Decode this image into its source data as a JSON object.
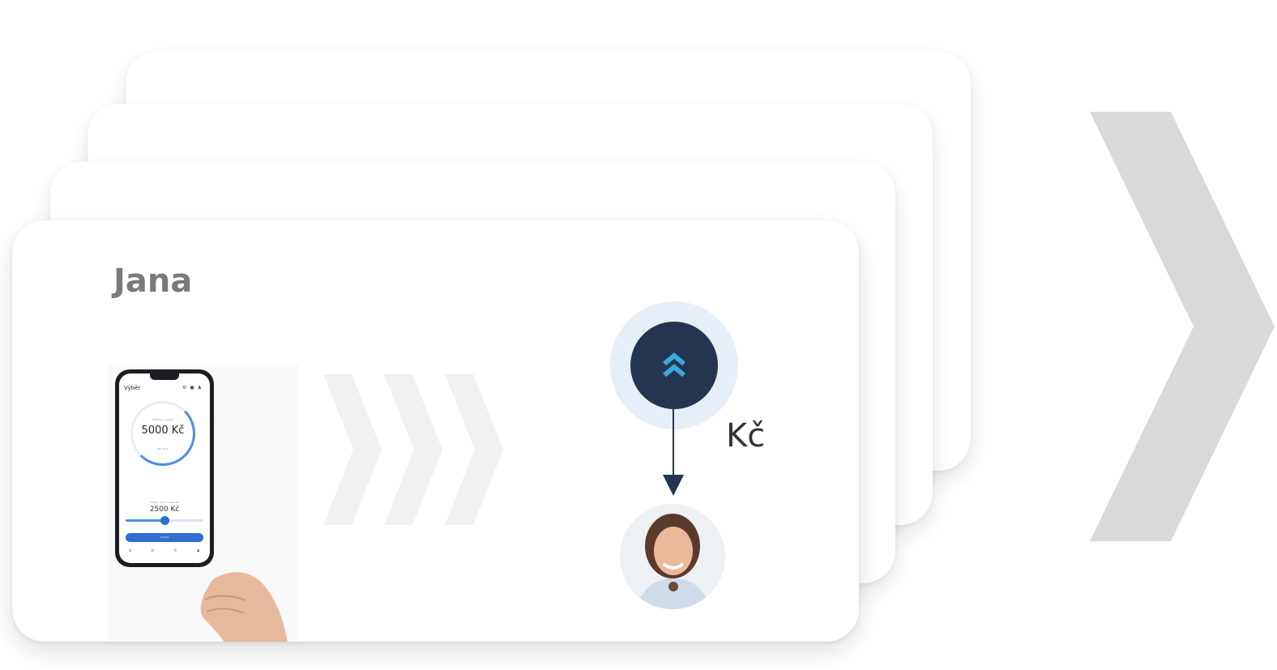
{
  "card": {
    "name": "Jana",
    "currency": "Kč"
  },
  "phone_app": {
    "title": "Výběr",
    "ring_caption": "Můžete si vybrat",
    "ring_value": "5000 Kč",
    "ring_link": "Jak na to",
    "slider_caption": "Částka, kterou vyberete",
    "slider_value": "2500  Kč",
    "slider_level": 0.5,
    "button_label": "Vybrat"
  },
  "colors": {
    "badge_navy": "#24364f",
    "badge_accent": "#3aa7e0",
    "halo": "#e6eef8",
    "chevron_light": "#f1f1f1",
    "chevron_big": "#d9d9d9",
    "name_gray": "#7a7a7a",
    "app_blue": "#2e6fd1"
  },
  "icons": {
    "badge": "double-chevron-up-icon",
    "flow": "triple-chevron-right-icon",
    "next": "large-chevron-right-icon",
    "arrow": "arrow-down-icon"
  }
}
